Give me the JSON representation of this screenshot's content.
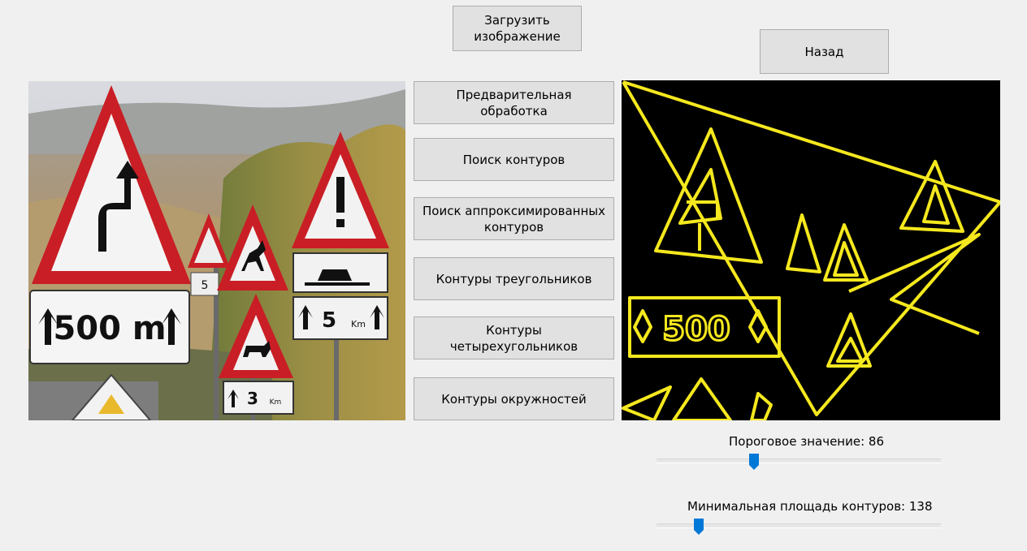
{
  "toolbar": {
    "load_image_label": "Загрузить\nизображение",
    "back_label": "Назад"
  },
  "actions": [
    {
      "label": "Предварительная\nобработка"
    },
    {
      "label": "Поиск контуров"
    },
    {
      "label": "Поиск аппроксимированных\nконтуров"
    },
    {
      "label": "Контуры треугольников"
    },
    {
      "label": "Контуры\nчетырехугольников"
    },
    {
      "label": "Контуры окружностей"
    }
  ],
  "source_image": {
    "signs": {
      "distance_plate": "500 m",
      "plate_mid": "5",
      "plate_mid_unit": "Km",
      "plate_low": "3",
      "plate_low_unit": "Km",
      "small_plate": "5"
    }
  },
  "result_image": {
    "contour_color": "#f5e81e",
    "background": "#000000",
    "contour_text": "500"
  },
  "sliders": {
    "threshold": {
      "label": "Пороговое значение: 86",
      "value": 86,
      "max": 255
    },
    "min_area": {
      "label": "Минимальная площадь контуров: 138",
      "value": 138,
      "max": 1000
    }
  },
  "colors": {
    "accent": "#0078d7",
    "button_bg": "#e1e1e1",
    "button_border": "#adadad"
  }
}
